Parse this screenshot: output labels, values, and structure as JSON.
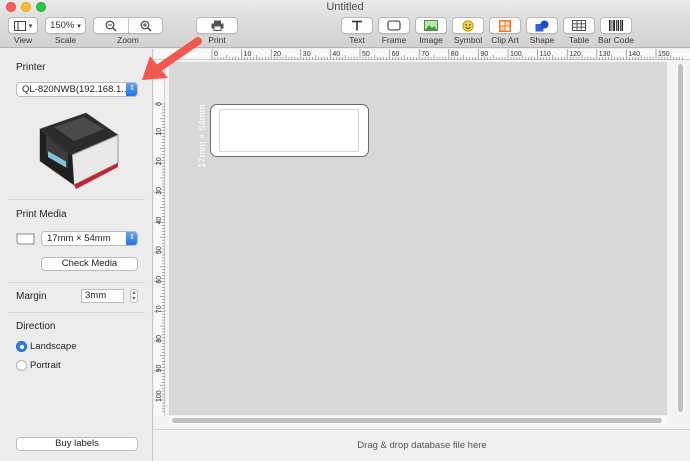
{
  "window": {
    "title": "Untitled"
  },
  "toolbar": {
    "view_label": "View",
    "scale_value": "150%",
    "scale_label": "Scale",
    "zoom_label": "Zoom",
    "print_label": "Print",
    "tools": [
      {
        "label": "Text",
        "icon": "text-icon"
      },
      {
        "label": "Frame",
        "icon": "frame-icon"
      },
      {
        "label": "Image",
        "icon": "image-icon"
      },
      {
        "label": "Symbol",
        "icon": "smiley-icon"
      },
      {
        "label": "Clip Art",
        "icon": "clip-art-icon"
      },
      {
        "label": "Shape",
        "icon": "shape-icon"
      },
      {
        "label": "Table",
        "icon": "table-icon"
      },
      {
        "label": "Bar Code",
        "icon": "barcode-icon"
      }
    ]
  },
  "sidebar": {
    "printer_title": "Printer",
    "printer_value": "QL-820NWB(192.168.1....",
    "media_title": "Print Media",
    "media_value": "17mm × 54mm",
    "check_media_label": "Check Media",
    "margin_title": "Margin",
    "margin_value": "3mm",
    "direction_title": "Direction",
    "landscape_label": "Landscape",
    "portrait_label": "Portrait",
    "buy_labels_label": "Buy labels"
  },
  "canvas": {
    "label_size_text": "17mm × 54mm",
    "ruler_top": [
      "0",
      "10",
      "20",
      "30",
      "40",
      "50",
      "60",
      "70",
      "80",
      "90",
      "100",
      "110",
      "120",
      "130",
      "140",
      "150"
    ],
    "ruler_left": [
      "0",
      "10",
      "20",
      "30",
      "40",
      "50",
      "60",
      "70",
      "80",
      "90",
      "100"
    ],
    "dropzone_text": "Drag & drop database file here"
  },
  "colors": {
    "accent": "#2a7df3",
    "arrow": "#f0594c"
  }
}
